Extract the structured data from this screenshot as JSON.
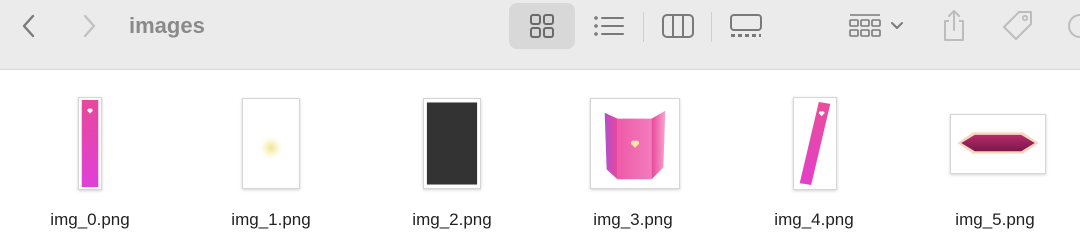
{
  "window": {
    "folder_title": "images"
  },
  "toolbar": {
    "back_icon": "chevron-left-icon",
    "forward_icon": "chevron-right-icon",
    "views": [
      {
        "name": "icon-view",
        "icon": "grid-icon",
        "selected": true
      },
      {
        "name": "list-view",
        "icon": "list-icon",
        "selected": false
      },
      {
        "name": "column-view",
        "icon": "columns-icon",
        "selected": false
      },
      {
        "name": "gallery-view",
        "icon": "gallery-icon",
        "selected": false
      }
    ],
    "group_icon": "group-grid-icon",
    "share_icon": "share-icon",
    "tag_icon": "tag-icon"
  },
  "files": [
    {
      "name": "img_0.png"
    },
    {
      "name": "img_1.png"
    },
    {
      "name": "img_2.png"
    },
    {
      "name": "img_3.png"
    },
    {
      "name": "img_4.png"
    },
    {
      "name": "img_5.png"
    }
  ],
  "colors": {
    "toolbar_bg": "#ebebeb",
    "selected_view_bg": "#d8d8d8",
    "icon_gray": "#8a8a8a",
    "pink": "#e8479a",
    "magenta": "#e040d8",
    "dark_thumb": "#333333",
    "maroon": "#8c1e52"
  }
}
